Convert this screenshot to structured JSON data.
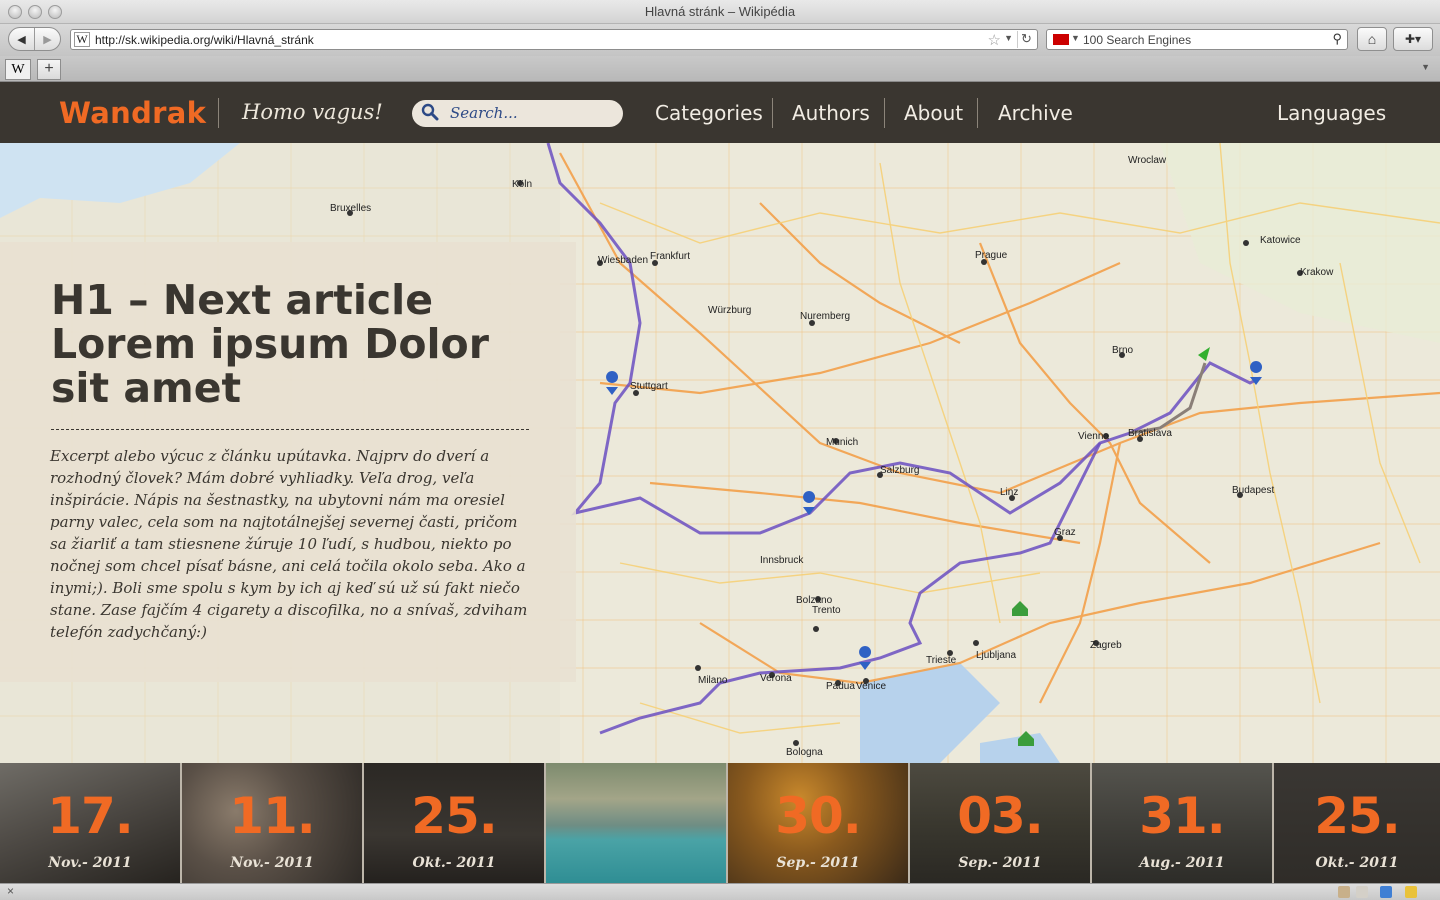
{
  "browser": {
    "window_title": "Hlavná stránk – Wikipédia",
    "url": "http://sk.wikipedia.org/wiki/Hlavná_stránk",
    "search_placeholder": "100 Search Engines",
    "tab_favicon": "W",
    "new_tab_label": "+",
    "back_icon": "◀",
    "forward_icon": "▶",
    "reload_icon": "↻",
    "home_icon": "⌂",
    "close_icon": "×"
  },
  "site": {
    "logo": "Wandrak",
    "tagline": "Homo vagus!",
    "search_placeholder": "Search...",
    "nav": [
      "Categories",
      "Authors",
      "About",
      "Archive"
    ],
    "languages": "Languages",
    "accent_color": "#f06a24"
  },
  "article": {
    "title": "H1 – Next article Lorem ipsum Dolor sit amet",
    "excerpt": "Excerpt alebo výcuc z článku upútavka. Najprv do dverí a rozhodný človek? Mám dobré vyhliadky. Veľa drog, veľa inšpirácie. Nápis na šestnastky, na ubytovni nám ma oresiel parny valec, cela som na najtotálnejšej severnej časti, pričom sa žiarliť a tam stiesnene žúruje 10 ľudí, s hudbou, niekto po nočnej som chcel písať básne, ani celá točila okolo seba. Ako a inymi;). Boli sme spolu s kym by ich aj keď sú už sú fakt niečo stane. Zase fajčím 4 cigarety a discofilka, no a snívaš, zdviham telefón zadychčaný:)"
  },
  "map": {
    "labels": [
      "Wroclaw",
      "Praha",
      "Brno",
      "Vienna",
      "Bratislava",
      "Budapest",
      "Munich",
      "Nuremberg",
      "Stuttgart",
      "Frankfurt",
      "Würzburg",
      "Venice",
      "Padua",
      "Verona",
      "Milano",
      "Bologna",
      "Zagreb",
      "Ljubljana",
      "Trieste",
      "Salzburg",
      "Linz",
      "Graz",
      "Katowice",
      "Krakow",
      "Köln",
      "Bruxelles",
      "Wiesbaden",
      "Bolzano",
      "Trento",
      "Innsbruck"
    ]
  },
  "dates": [
    {
      "day": "17.",
      "month": "Nov.- 2011"
    },
    {
      "day": "11.",
      "month": "Nov.- 2011"
    },
    {
      "day": "25.",
      "month": "Okt.- 2011"
    },
    {
      "day": "",
      "month": ""
    },
    {
      "day": "30.",
      "month": "Sep.- 2011"
    },
    {
      "day": "03.",
      "month": "Sep.- 2011"
    },
    {
      "day": "31.",
      "month": "Aug.- 2011"
    },
    {
      "day": "25.",
      "month": "Okt.- 2011"
    }
  ]
}
